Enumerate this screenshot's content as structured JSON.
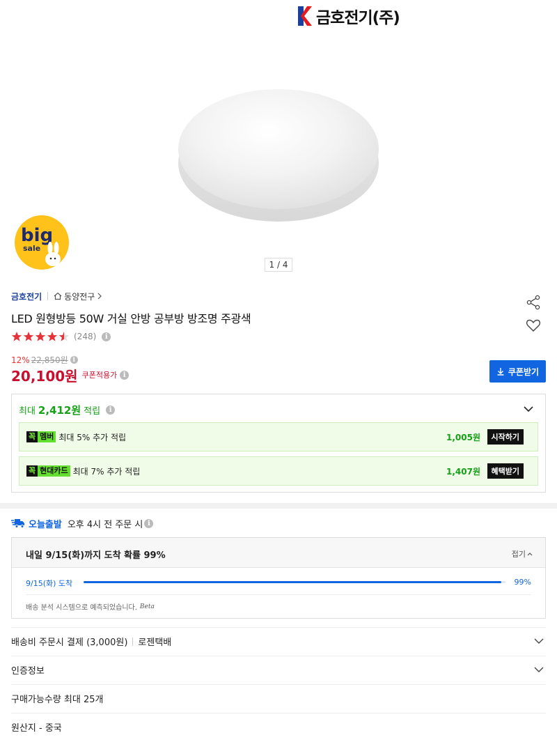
{
  "brand_logo": {
    "text": "금호전기(주)",
    "mark_color": "#e31c23"
  },
  "gallery": {
    "counter": "1 / 4",
    "sale_badge": {
      "big": "big",
      "sale": "sale"
    }
  },
  "breadcrumb": {
    "brand": "금호전기",
    "category": "동양전구"
  },
  "product": {
    "title": "LED 원형방등 50W 거실 안방 공부방 방조명 주광색",
    "rating_stars": 4.5,
    "review_count": "(248)",
    "discount_rate": "12%",
    "original_price": "22,850원",
    "price": "20,100원",
    "coupon_applied": "쿠폰적용가",
    "coupon_button": "쿠폰받기"
  },
  "rewards": {
    "head_prefix": "최대",
    "head_amount": "2,412원",
    "head_suffix": "적립",
    "rows": [
      {
        "badge_a": "꼭",
        "badge_b": "멤버",
        "desc": "최대 5% 추가 적립",
        "amount": "1,005원",
        "button": "시작하기"
      },
      {
        "badge_a": "꼭",
        "badge_b": "현대카드",
        "desc": "최대 7% 추가 적립",
        "amount": "1,407원",
        "button": "혜택받기"
      }
    ]
  },
  "delivery": {
    "today_label": "오늘출발",
    "today_text": "오후 4시 전 주문 시",
    "title": "내일 9/15(화)까지 도착 확률 99%",
    "collapse": "접기",
    "date": "9/15(화) 도착",
    "percent": "99%",
    "progress": 0.99,
    "note": "배송 분석 시스템으로 예측되었습니다.",
    "beta": "Beta"
  },
  "info_rows": {
    "shipping": "배송비 주문시 결제 (3,000원)",
    "courier": "로젠택배",
    "cert": "인증정보",
    "max_qty": "구매가능수량 최대 25개",
    "origin": "원산지 - 중국"
  },
  "colors": {
    "accent_blue": "#1165e0",
    "price_red": "#c8102e",
    "star_red": "#e5333b",
    "reward_green": "#16a016"
  }
}
